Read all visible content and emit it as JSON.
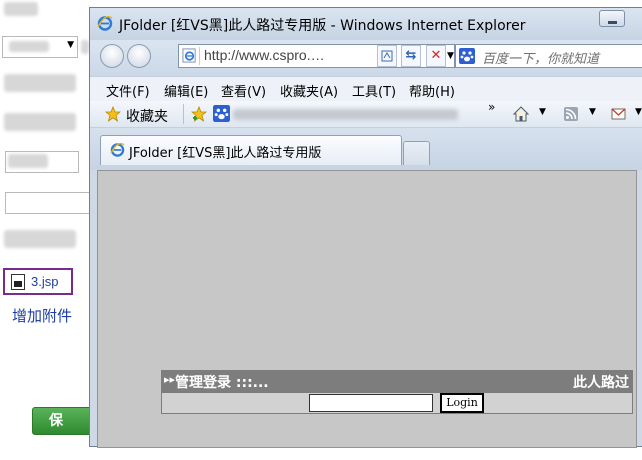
{
  "background_page": {
    "attachment_file": "3.jsp",
    "add_attachment": "增加附件",
    "save_button": "保 存"
  },
  "browser": {
    "window_title": "JFolder [红VS黑]此人路过专用版 - Windows Internet Explorer",
    "address": "http://www.cspro.…",
    "search_placeholder": "百度一下，你就知道",
    "menu": [
      "文件(F)",
      "编辑(E)",
      "查看(V)",
      "收藏夹(A)",
      "工具(T)",
      "帮助(H)"
    ],
    "favorites_label": "收藏夹",
    "chevron": "»",
    "tab_label": "JFolder [红VS黑]此人路过专用版"
  },
  "login_panel": {
    "title": "管理登录 :::...",
    "right_text": "此人路过",
    "password_value": "",
    "login_button": "Login"
  },
  "colors": {
    "content_bg": "#c7c7c7",
    "login_header_bg": "#7d7d7d",
    "save_button_bg": "#3f9c3f",
    "link_blue": "#1d3fa5",
    "attachment_border": "#7a2a8f"
  }
}
